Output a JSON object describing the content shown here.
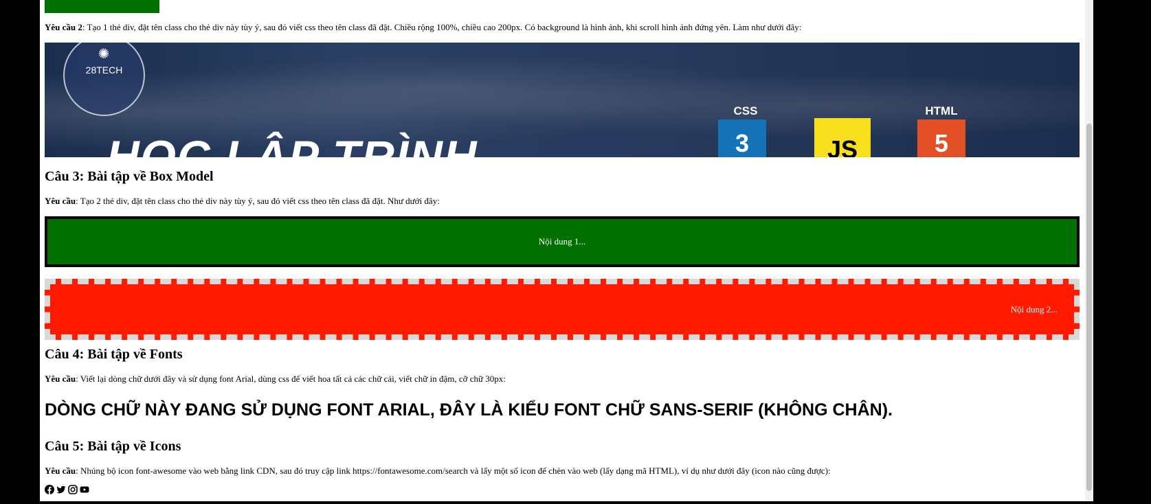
{
  "q2": {
    "req_label": "Yêu cầu 2",
    "req_text": ": Tạo 1 thẻ div, đặt tên class cho thẻ div này tùy ý, sau đó viết css theo tên class đã đặt. Chiều rộng 100%, chiều cao 200px. Có background là hình ảnh, khi scroll hình ảnh đứng yên. Làm như dưới đây:"
  },
  "banner": {
    "logo_text": "28TECH",
    "big_text": "HỌC LẬP TRÌNH",
    "css_label": "CSS",
    "html_label": "HTML",
    "js_label": "JS",
    "css_glyph": "3",
    "html_glyph": "5"
  },
  "q3": {
    "title": "Câu 3: Bài tập về Box Model",
    "req_label": "Yêu cầu",
    "req_text": ": Tạo 2 thẻ div, đặt tên class cho thẻ div này tùy ý, sau đó viết css theo tên class đã đặt. Như dưới đây:",
    "box1_text": "Nội dung 1...",
    "box2_text": "Nội dung 2..."
  },
  "q4": {
    "title": "Câu 4: Bài tập về Fonts",
    "req_label": "Yêu cầu",
    "req_text": ": Viết lại dòng chữ dưới đây và sử dụng font Arial, dùng css để viết hoa tất cả các chữ cái, viết chữ in đậm, cỡ chữ 30px:",
    "sample": "DÒNG CHỮ NÀY ĐANG SỬ DỤNG FONT ARIAL, ĐÂY LÀ KIỂU FONT CHỮ SANS-SERIF (KHÔNG CHÂN)."
  },
  "q5": {
    "title": "Câu 5: Bài tập về Icons",
    "req_label": "Yêu cầu",
    "req_text": ": Nhúng bộ icon font-awesome vào web bằng link CDN, sau đó truy cập link https://fontawesome.com/search và lấy một số icon để chèn vào web (lấy dạng mã HTML), ví dụ như dưới đây (icon nào cũng được):",
    "icons": [
      "facebook-icon",
      "twitter-icon",
      "instagram-icon",
      "youtube-icon"
    ]
  },
  "colors": {
    "green": "#007000",
    "red": "#ff1a00",
    "dash": "#d9d9d9",
    "css_blue": "#1572b6",
    "js_yellow": "#f7df1e",
    "html_orange": "#e34f26"
  }
}
